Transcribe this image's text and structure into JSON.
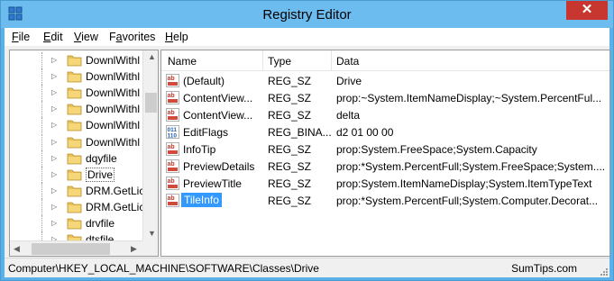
{
  "window": {
    "title": "Registry Editor",
    "close_glyph": "✕"
  },
  "menu": [
    {
      "label": "File",
      "accel": "F",
      "rest": "ile"
    },
    {
      "label": "Edit",
      "accel": "E",
      "rest": "dit"
    },
    {
      "label": "View",
      "accel": "V",
      "rest": "iew"
    },
    {
      "label": "Favorites",
      "accel": "a",
      "pre": "F",
      "rest": "vorites"
    },
    {
      "label": "Help",
      "accel": "H",
      "rest": "elp"
    }
  ],
  "tree": {
    "items": [
      {
        "label": "DownlWithl",
        "expandable": true
      },
      {
        "label": "DownlWithl",
        "expandable": true
      },
      {
        "label": "DownlWithl",
        "expandable": true
      },
      {
        "label": "DownlWithl",
        "expandable": true
      },
      {
        "label": "DownlWithl",
        "expandable": true
      },
      {
        "label": "DownlWithl",
        "expandable": true
      },
      {
        "label": "dqyfile",
        "expandable": true
      },
      {
        "label": "Drive",
        "expandable": true,
        "selected": true
      },
      {
        "label": "DRM.GetLic",
        "expandable": true
      },
      {
        "label": "DRM.GetLic",
        "expandable": true
      },
      {
        "label": "drvfile",
        "expandable": true
      },
      {
        "label": "dtsfile",
        "expandable": true
      }
    ]
  },
  "values": {
    "columns": {
      "name": "Name",
      "type": "Type",
      "data": "Data"
    },
    "rows": [
      {
        "icon": "string-value-icon",
        "name": "(Default)",
        "type": "REG_SZ",
        "data": "Drive"
      },
      {
        "icon": "string-value-icon",
        "name": "ContentView...",
        "type": "REG_SZ",
        "data": "prop:~System.ItemNameDisplay;~System.PercentFul..."
      },
      {
        "icon": "string-value-icon",
        "name": "ContentView...",
        "type": "REG_SZ",
        "data": "delta"
      },
      {
        "icon": "binary-value-icon",
        "name": "EditFlags",
        "type": "REG_BINA...",
        "data": "d2 01 00 00"
      },
      {
        "icon": "string-value-icon",
        "name": "InfoTip",
        "type": "REG_SZ",
        "data": "prop:System.FreeSpace;System.Capacity"
      },
      {
        "icon": "string-value-icon",
        "name": "PreviewDetails",
        "type": "REG_SZ",
        "data": "prop:*System.PercentFull;System.FreeSpace;System...."
      },
      {
        "icon": "string-value-icon",
        "name": "PreviewTitle",
        "type": "REG_SZ",
        "data": "prop:System.ItemNameDisplay;System.ItemTypeText"
      },
      {
        "icon": "string-value-icon",
        "name": "TileInfo",
        "type": "REG_SZ",
        "data": "prop:*System.PercentFull;System.Computer.Decorat...",
        "selected": true
      }
    ]
  },
  "status": {
    "path": "Computer\\HKEY_LOCAL_MACHINE\\SOFTWARE\\Classes\\Drive",
    "brand": "SumTips.com"
  },
  "colors": {
    "titlebar": "#6cbcef",
    "close": "#c7372f",
    "selection": "#3399ff",
    "folder": "#e8c15a"
  }
}
